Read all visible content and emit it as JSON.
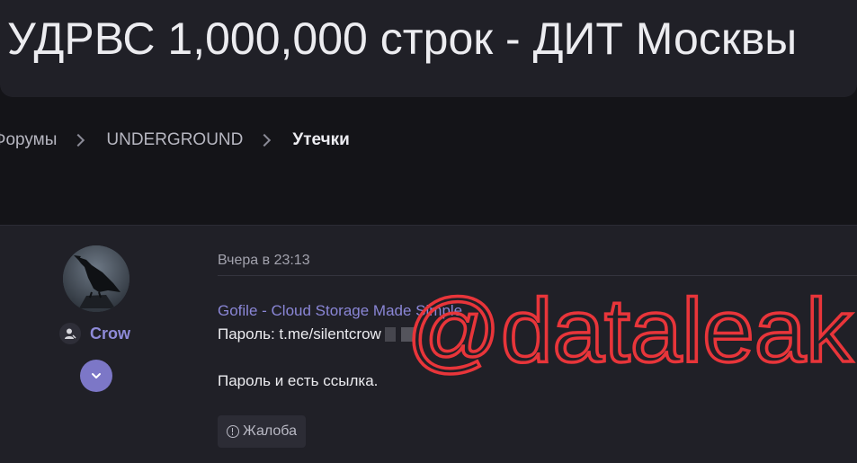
{
  "thread": {
    "title": "УДРВС 1,000,000 строк - ДИТ Москвы"
  },
  "breadcrumb": {
    "items": [
      "Форумы",
      "UNDERGROUND",
      "Утечки"
    ]
  },
  "post": {
    "author": "Crow",
    "date": "Вчера в 23:13",
    "link_text": "Gofile - Cloud Storage Made Simple",
    "password_line": "Пароль: t.me/silentcrow",
    "body_line": "Пароль и есть ссылка.",
    "report_label": "Жалоба"
  },
  "watermark": {
    "text": "@dataleak",
    "color": "#e8353a"
  },
  "icons": {
    "author_badge": "user-icon",
    "expand": "chevron-down-icon",
    "report": "alert-circle-icon"
  },
  "colors": {
    "accent": "#7c77c7",
    "link": "#8a86d6",
    "background": "#141418",
    "panel": "#202027"
  }
}
